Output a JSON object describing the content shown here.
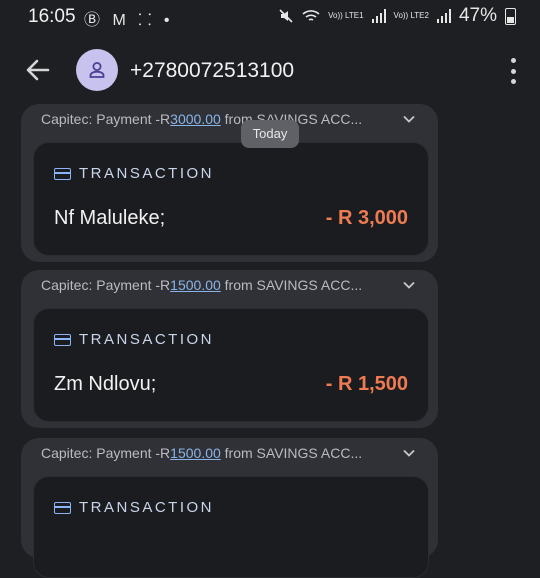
{
  "status_bar": {
    "time": "16:05",
    "left_icons": [
      "b-icon",
      "m-icon",
      "dots-icon",
      "dot-icon"
    ],
    "left_glyphs": "Ⓑ M ⸬ •",
    "volte1": "Vo)) LTE1",
    "volte2": "Vo)) LTE2",
    "battery": "47%"
  },
  "header": {
    "phone": "+2780072513100"
  },
  "date_chip": "Today",
  "messages": [
    {
      "summary_prefix": "Capitec: Payment -R",
      "summary_amount": "3000.00",
      "summary_suffix": " from SAVINGS ACC...",
      "label": "TRANSACTION",
      "name": "Nf Maluleke;",
      "amount": "- R 3,000"
    },
    {
      "summary_prefix": "Capitec: Payment -R",
      "summary_amount": "1500.00",
      "summary_suffix": " from SAVINGS ACC...",
      "label": "TRANSACTION",
      "name": "Zm Ndlovu;",
      "amount": "- R 1,500"
    },
    {
      "summary_prefix": "Capitec: Payment -R",
      "summary_amount": "1500.00",
      "summary_suffix": " from SAVINGS ACC...",
      "label": "TRANSACTION"
    }
  ],
  "colors": {
    "background": "#1d1f23",
    "bubble": "#2f3136",
    "card": "#1b1c20",
    "amount": "#ef7b52",
    "link": "#8ab4e8",
    "avatar": "#c7c2ee"
  }
}
